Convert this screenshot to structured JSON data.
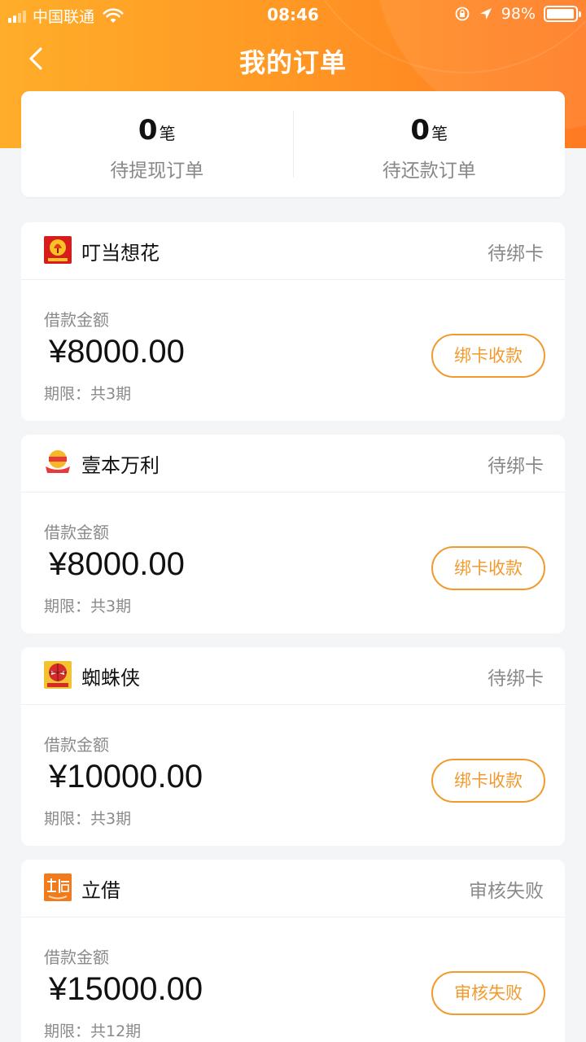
{
  "status_bar": {
    "carrier": "中国联通",
    "time": "08:46",
    "battery": "98%"
  },
  "header": {
    "title": "我的订单",
    "back_icon": "chevron-left-icon"
  },
  "summary": [
    {
      "count": "0",
      "unit": "笔",
      "label": "待提现订单"
    },
    {
      "count": "0",
      "unit": "笔",
      "label": "待还款订单"
    }
  ],
  "orders": [
    {
      "brand": "叮当想花",
      "status": "待绑卡",
      "amount_label": "借款金额",
      "amount": "¥8000.00",
      "term": "期限：共3期",
      "action": "绑卡收款",
      "logo": "bell-logo",
      "logo_color": "#d71c1c"
    },
    {
      "brand": "壹本万利",
      "status": "待绑卡",
      "amount_label": "借款金额",
      "amount": "¥8000.00",
      "term": "期限：共3期",
      "action": "绑卡收款",
      "logo": "ingot-logo",
      "logo_color": "#e83a3a"
    },
    {
      "brand": "蜘蛛侠",
      "status": "待绑卡",
      "amount_label": "借款金额",
      "amount": "¥10000.00",
      "term": "期限：共3期",
      "action": "绑卡收款",
      "logo": "spider-logo",
      "logo_color": "#f2c230"
    },
    {
      "brand": "立借",
      "status": "审核失败",
      "amount_label": "借款金额",
      "amount": "¥15000.00",
      "term": "期限：共12期",
      "action": "审核失败",
      "logo": "lijie-logo",
      "logo_color": "#f07a1c"
    }
  ],
  "colors": {
    "accent": "#f29a2e",
    "header_orange": "#ff8f24"
  }
}
